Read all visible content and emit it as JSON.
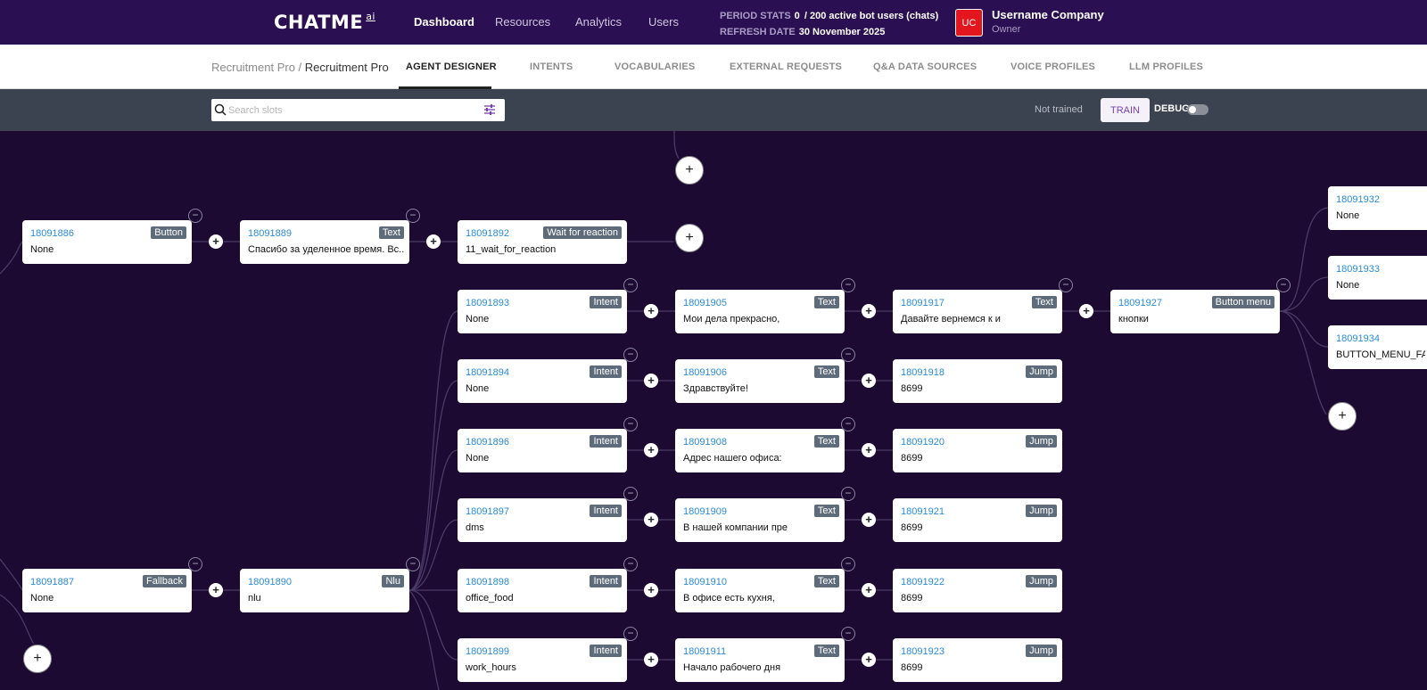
{
  "topbar": {
    "logo": "CHATME",
    "logo_sup": "ai",
    "nav": [
      "Dashboard",
      "Resources",
      "Analytics",
      "Users"
    ],
    "active_nav": "Dashboard",
    "stats": {
      "period_label": "PERIOD STATS",
      "period_value": "0",
      "period_suffix": "/ 200 active bot users (chats)",
      "refresh_label": "REFRESH DATE",
      "refresh_value": "30 November 2025"
    },
    "user": {
      "initials": "UC",
      "name": "Username Company",
      "role": "Owner",
      "avatar_color": "#e3161d"
    }
  },
  "subnav": {
    "breadcrumb_parent": "Recruitment Pro /",
    "breadcrumb_current": "Recruitment Pro",
    "tabs": [
      "AGENT DESIGNER",
      "INTENTS",
      "VOCABULARIES",
      "EXTERNAL REQUESTS",
      "Q&A DATA SOURCES",
      "VOICE PROFILES",
      "LLM PROFILES"
    ],
    "active_tab": "AGENT DESIGNER"
  },
  "toolbar": {
    "search_placeholder": "Search slots",
    "status": "Not trained",
    "train_label": "TRAIN",
    "debug_label": "DEBUG",
    "debug_on": false
  },
  "colors": {
    "canvas_bg": "#1c0a33",
    "header_bg": "#2a0f52",
    "toolbar_bg": "#3c4350",
    "node_id": "#2a8bd8",
    "type_badge": "#5e6b7a"
  },
  "nodes": [
    {
      "id": "18091886",
      "type": "Button",
      "text": "None"
    },
    {
      "id": "18091889",
      "type": "Text",
      "text": "Спасибо за уделенное время. Вс..."
    },
    {
      "id": "18091892",
      "type": "Wait for reaction",
      "text": "11_wait_for_reaction"
    },
    {
      "id": "18091893",
      "type": "Intent",
      "text": "None"
    },
    {
      "id": "18091905",
      "type": "Text",
      "text": "Мои дела прекрасно,"
    },
    {
      "id": "18091917",
      "type": "Text",
      "text": "Давайте вернемся к и"
    },
    {
      "id": "18091927",
      "type": "Button menu",
      "text": "кнопки"
    },
    {
      "id": "18091932",
      "type": "",
      "text": "None"
    },
    {
      "id": "18091933",
      "type": "",
      "text": "None"
    },
    {
      "id": "18091934",
      "type": "",
      "text": "BUTTON_MENU_FALL"
    },
    {
      "id": "18091894",
      "type": "Intent",
      "text": "None"
    },
    {
      "id": "18091906",
      "type": "Text",
      "text": "Здравствуйте!"
    },
    {
      "id": "18091918",
      "type": "Jump",
      "text": "8699"
    },
    {
      "id": "18091896",
      "type": "Intent",
      "text": "None"
    },
    {
      "id": "18091908",
      "type": "Text",
      "text": "Адрес нашего офиса:"
    },
    {
      "id": "18091920",
      "type": "Jump",
      "text": "8699"
    },
    {
      "id": "18091897",
      "type": "Intent",
      "text": "dms"
    },
    {
      "id": "18091909",
      "type": "Text",
      "text": "В нашей компании пре"
    },
    {
      "id": "18091921",
      "type": "Jump",
      "text": "8699"
    },
    {
      "id": "18091887",
      "type": "Fallback",
      "text": "None"
    },
    {
      "id": "18091890",
      "type": "Nlu",
      "text": "nlu"
    },
    {
      "id": "18091898",
      "type": "Intent",
      "text": "office_food"
    },
    {
      "id": "18091910",
      "type": "Text",
      "text": "В офисе есть кухня,"
    },
    {
      "id": "18091922",
      "type": "Jump",
      "text": "8699"
    },
    {
      "id": "18091899",
      "type": "Intent",
      "text": "work_hours"
    },
    {
      "id": "18091911",
      "type": "Text",
      "text": "Начало рабочего дня"
    },
    {
      "id": "18091923",
      "type": "Jump",
      "text": "8699"
    }
  ]
}
